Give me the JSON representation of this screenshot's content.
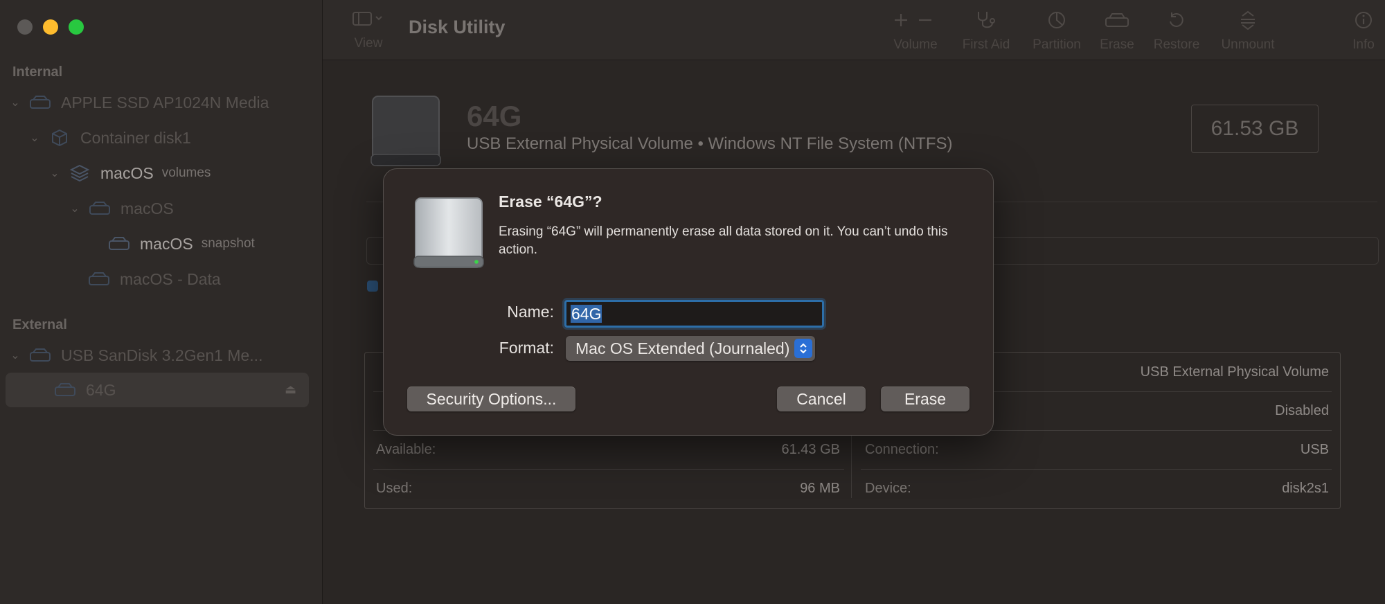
{
  "window": {
    "app_title": "Disk Utility"
  },
  "sidebar": {
    "internal_label": "Internal",
    "external_label": "External",
    "items": [
      {
        "label": "APPLE SSD AP1024N Media",
        "sub": ""
      },
      {
        "label": "Container disk1",
        "sub": ""
      },
      {
        "label": "macOS",
        "sub": "volumes"
      },
      {
        "label": "macOS",
        "sub": ""
      },
      {
        "label": "macOS",
        "sub": "snapshot"
      },
      {
        "label": "macOS - Data",
        "sub": ""
      },
      {
        "label": "USB SanDisk 3.2Gen1 Me...",
        "sub": ""
      },
      {
        "label": "64G",
        "sub": ""
      }
    ]
  },
  "toolbar": {
    "view_label": "View",
    "volume_label": "Volume",
    "first_aid_label": "First Aid",
    "partition_label": "Partition",
    "erase_label": "Erase",
    "restore_label": "Restore",
    "unmount_label": "Unmount",
    "info_label": "Info"
  },
  "volume": {
    "name": "64G",
    "description": "USB External Physical Volume • Windows NT File System (NTFS)",
    "size": "61.53 GB"
  },
  "info": {
    "left": [
      {
        "key": "",
        "value": ""
      },
      {
        "key": "",
        "value": ""
      },
      {
        "key": "Available:",
        "value": "61.43 GB"
      },
      {
        "key": "Used:",
        "value": "96 MB"
      }
    ],
    "right": [
      {
        "key": "",
        "value": "USB External Physical Volume"
      },
      {
        "key": "",
        "value": "Disabled"
      },
      {
        "key": "Connection:",
        "value": "USB"
      },
      {
        "key": "Device:",
        "value": "disk2s1"
      }
    ]
  },
  "dialog": {
    "title": "Erase “64G”?",
    "message": "Erasing “64G” will permanently erase all data stored on it. You can’t undo this action.",
    "name_label": "Name:",
    "name_value": "64G",
    "format_label": "Format:",
    "format_value": "Mac OS Extended (Journaled)",
    "security_button": "Security Options...",
    "cancel_button": "Cancel",
    "erase_button": "Erase"
  },
  "colors": {
    "accent": "#2a6fd6",
    "focus_ring": "#2d6ea8",
    "traffic_close": "#5c5957",
    "traffic_minimize": "#febc2e",
    "traffic_maximize": "#28c840"
  }
}
